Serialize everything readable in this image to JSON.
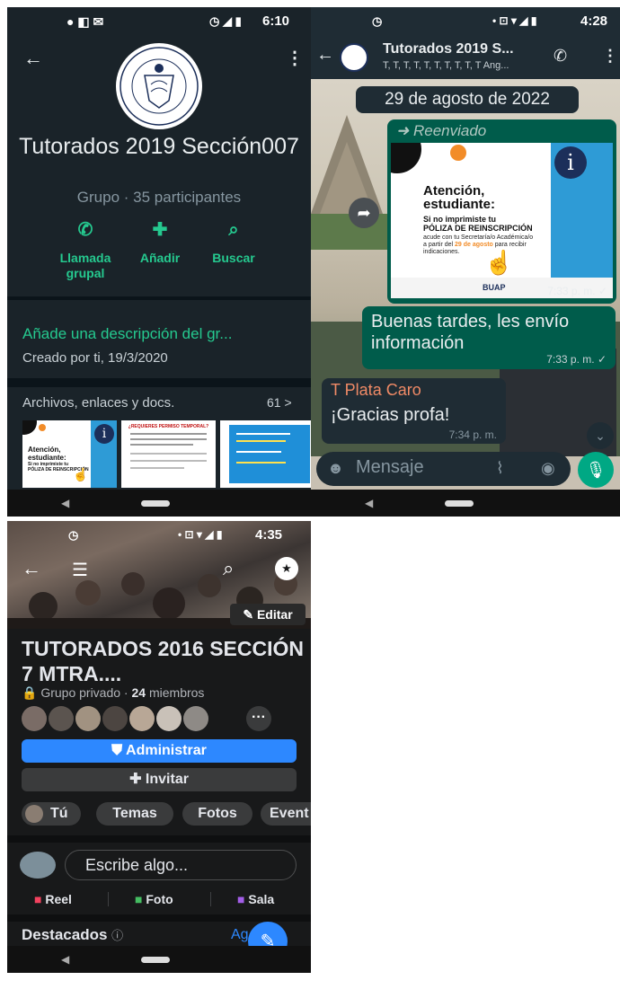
{
  "panel1": {
    "status_time": "6:10",
    "group_name": "Tutorados 2019 Sección007",
    "group_info": "Grupo · 35 participantes",
    "actions": [
      {
        "label": "Llamada grupal",
        "icon": "call-add-icon"
      },
      {
        "label": "Añadir",
        "icon": "add-person-icon"
      },
      {
        "label": "Buscar",
        "icon": "search-icon"
      }
    ],
    "description_prompt": "Añade una descripción del gr...",
    "created_by": "Creado por ti, 19/3/2020",
    "media_label": "Archivos, enlaces y docs.",
    "media_count": "61 >",
    "thumb1": {
      "line1": "Atención,",
      "line2": "estudiante:",
      "line3": "Si no imprimiste tu",
      "line4": "PÓLIZA DE REINSCRIPCIÓN"
    },
    "thumb2": {
      "line1": "¿REQUIERES PERMISO TEMPORAL?"
    }
  },
  "panel2": {
    "status_time": "4:28",
    "chat_title": "Tutorados 2019 S...",
    "chat_members": "T, T, T, T, T, T, T, T, T, T Ang...",
    "date_chip": "29 de agosto de 2022",
    "forwarded_label": "Reenviado",
    "poster": {
      "heading1": "Atención,",
      "heading2": "estudiante:",
      "bold1": "Si no imprimiste tu",
      "bold2": "PÓLIZA DE REINSCRIPCIÓN",
      "body1": "acude con tu Secretaría/o Académica/o",
      "body2a": "a partir del ",
      "body2b": "29 de agosto",
      "body2c": " para recibir",
      "body3": "indicaciones.",
      "footer": "BUAP"
    },
    "msg_time_image": "7:33 p. m.",
    "msg_text": "Buenas tardes, les envío información",
    "msg_time_text": "7:33 p. m.",
    "reply_sender": "T Plata Caro",
    "reply_text": "¡Gracias profa!",
    "reply_time": "7:34 p. m.",
    "input_placeholder": "Mensaje"
  },
  "panel3": {
    "status_time": "4:35",
    "edit_label": "Editar",
    "group_title": "TUTORADOS 2016 SECCIÓN 7 MTRA....",
    "privacy": "Grupo privado · ",
    "members_count": "24",
    "members_word": " miembros",
    "admin_button": "Administrar",
    "invite_button": "Invitar",
    "tabs": [
      "Tú",
      "Temas",
      "Fotos",
      "Event"
    ],
    "composer_placeholder": "Escribe algo...",
    "post_types": [
      "Reel",
      "Foto",
      "Sala"
    ],
    "featured_label": "Destacados",
    "featured_link": "Ag"
  },
  "colors": {
    "whatsapp_teal": "#25d366",
    "whatsapp_bubble": "#005c4b",
    "facebook_blue": "#2d88ff"
  }
}
